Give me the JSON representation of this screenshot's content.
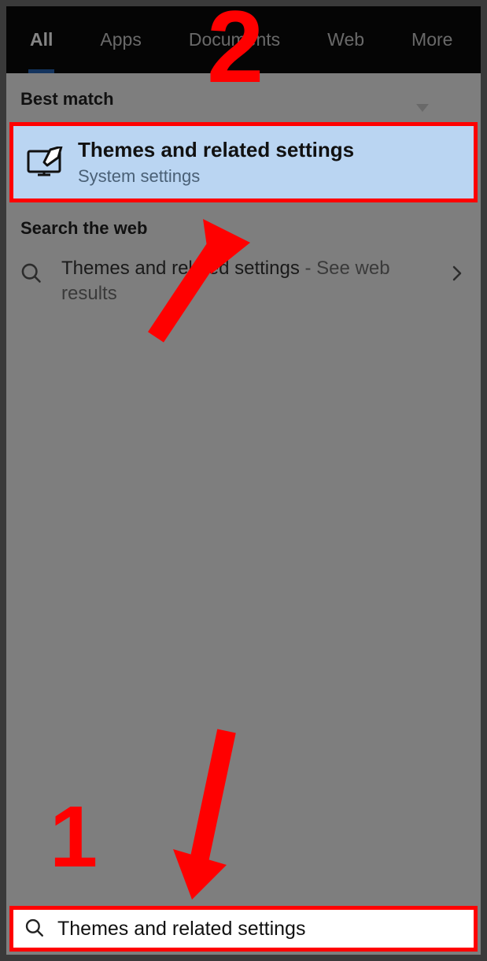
{
  "tabs": {
    "all": "All",
    "apps": "Apps",
    "documents": "Documents",
    "web": "Web",
    "more": "More"
  },
  "sections": {
    "best_match": "Best match",
    "search_web": "Search the web"
  },
  "best_match": {
    "title": "Themes and related settings",
    "subtitle": "System settings"
  },
  "web_result": {
    "query": "Themes and related settings",
    "suffix_sep": " - ",
    "suffix": "See web results"
  },
  "searchbox": {
    "value": "Themes and related settings"
  },
  "annotations": {
    "step1": "1",
    "step2": "2"
  }
}
